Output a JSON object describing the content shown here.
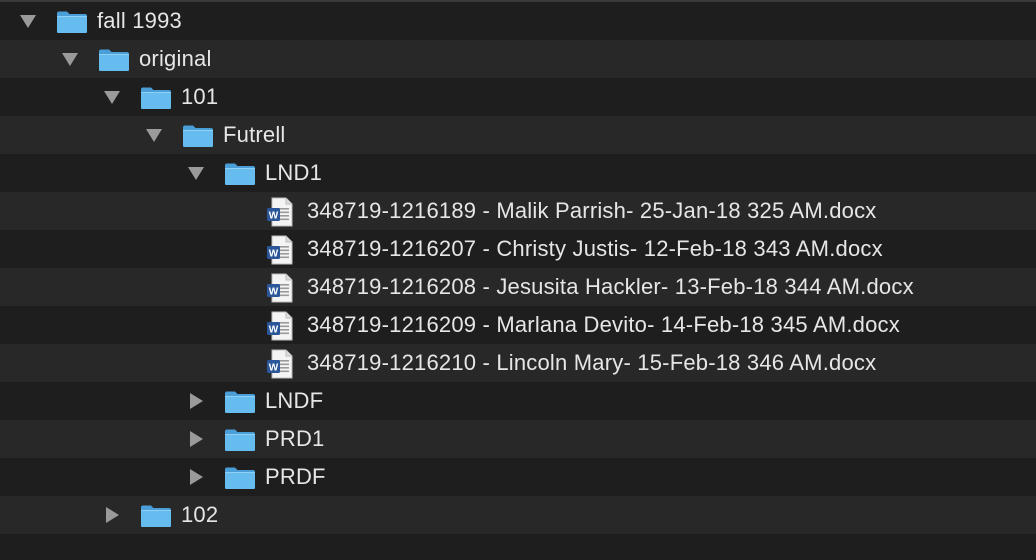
{
  "window": {
    "title": ""
  },
  "tree": {
    "root": {
      "label": "fall 1993",
      "icon": "folder-icon",
      "expanded": true
    },
    "original": {
      "label": "original",
      "icon": "folder-icon",
      "expanded": true
    },
    "f101": {
      "label": "101",
      "icon": "folder-icon",
      "expanded": true
    },
    "futrell": {
      "label": "Futrell",
      "icon": "folder-icon",
      "expanded": true
    },
    "lnd1": {
      "label": "LND1",
      "icon": "folder-icon",
      "expanded": true
    },
    "files": [
      {
        "label": "348719-1216189 - Malik Parrish- 25-Jan-18 325 AM.docx",
        "icon": "word-doc-icon"
      },
      {
        "label": "348719-1216207 - Christy Justis- 12-Feb-18 343 AM.docx",
        "icon": "word-doc-icon"
      },
      {
        "label": "348719-1216208 - Jesusita Hackler- 13-Feb-18 344 AM.docx",
        "icon": "word-doc-icon"
      },
      {
        "label": "348719-1216209 - Marlana Devito- 14-Feb-18 345 AM.docx",
        "icon": "word-doc-icon"
      },
      {
        "label": "348719-1216210 - Lincoln Mary- 15-Feb-18 346 AM.docx",
        "icon": "word-doc-icon"
      }
    ],
    "lndf": {
      "label": "LNDF",
      "icon": "folder-icon",
      "expanded": false
    },
    "prd1": {
      "label": "PRD1",
      "icon": "folder-icon",
      "expanded": false
    },
    "prdf": {
      "label": "PRDF",
      "icon": "folder-icon",
      "expanded": false
    },
    "f102": {
      "label": "102",
      "icon": "folder-icon",
      "expanded": false
    }
  },
  "colors": {
    "background": "#1e1e1e",
    "row_stripe": "#282828",
    "text": "#e6e6e6",
    "disclosure": "#9a9a9a",
    "folder": "#5fb3e8",
    "word_blue": "#2b579a"
  }
}
